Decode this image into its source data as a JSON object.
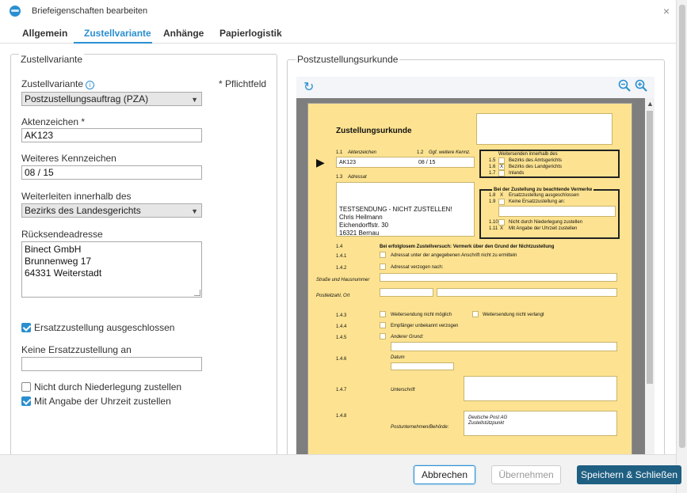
{
  "window": {
    "title": "Briefeigenschaften bearbeiten",
    "close_symbol": "×"
  },
  "tabs": [
    {
      "label": "Allgemein"
    },
    {
      "label": "Zustellvariante"
    },
    {
      "label": "Anhänge"
    },
    {
      "label": "Papierlogistik"
    }
  ],
  "form": {
    "legend": "Zustellvariante",
    "required_note": "* Pflichtfeld",
    "zustellvariante": {
      "label": "Zustellvariante",
      "value": "Postzustellungsauftrag (PZA)"
    },
    "aktenzeichen": {
      "label": "Aktenzeichen *",
      "value": "AK123"
    },
    "weiteres_kennzeichen": {
      "label": "Weiteres Kennzeichen",
      "value": "08 / 15"
    },
    "weiterleiten": {
      "label": "Weiterleiten innerhalb des",
      "value": "Bezirks des Landesgerichts"
    },
    "ruecksendeadresse": {
      "label": "Rücksendeadresse",
      "lines": [
        "Binect GmbH",
        "Brunnenweg 17",
        "64331 Weiterstadt"
      ]
    },
    "ersatzzustellung_ausgeschlossen": {
      "label": "Ersatzzustellung ausgeschlossen",
      "checked": true
    },
    "keine_ersatzzustellung": {
      "label": "Keine Ersatzzustellung an",
      "value": ""
    },
    "nicht_niederlegung": {
      "label": "Nicht durch Niederlegung zustellen",
      "checked": false
    },
    "mit_uhrzeit": {
      "label": "Mit Angabe der Uhrzeit zustellen",
      "checked": true
    }
  },
  "preview": {
    "legend": "Postzustellungsurkunde",
    "icons": {
      "refresh": "refresh-icon",
      "zoom_out": "zoom-out-icon",
      "zoom_in": "zoom-in-icon"
    },
    "doc": {
      "title": "Zustellungsurkunde",
      "n11": "1.1",
      "aktenzeichen_label": "Aktenzeichen",
      "aktenzeichen_value": "AK123",
      "n12": "1.2",
      "kennz_label": "Ggf. weitere Kennz.",
      "kennz_value": "08 / 15",
      "n13": "1.3",
      "adressat_label": "Adressat",
      "adressat_lines": [
        "TESTSENDUNG - NICHT ZUSTELLEN!",
        "Chris Heilmann",
        "Eichendorffstr. 30",
        "16321 Bernau"
      ],
      "weitersenden_title": "Weitersenden innerhalb des",
      "n15": "1.5",
      "ws_1": "Bezirks des Amtsgerichts",
      "n16": "1.6",
      "ws_2": "Bezirks des Landgerichts",
      "n17": "1.7",
      "ws_3": "Inlands",
      "vermerke_title": "Bei der Zustellung zu beachtende Vermerke",
      "n18": "1.8",
      "v_1": "Ersatzzustellung ausgeschlossen",
      "n19": "1.9",
      "v_2": "Keine Ersatzzustellung an:",
      "n110": "1.10",
      "v_3": "Nicht durch Niederlegung zustellen",
      "n111": "1.11",
      "v_4": "Mit Angabe der Uhrzeit zustellen",
      "n14": "1.4",
      "s14": "Bei erfolglosem Zustellversuch: Vermerk über den Grund der Nichtzustellung",
      "n141": "1.4.1",
      "s141": "Adressat unter der angegebenen Anschrift nicht zu ermitteln",
      "n142": "1.4.2",
      "s142": "Adressat verzogen nach:",
      "strasse": "Straße und Hausnummer",
      "plz": "Postleitzahl, Ort",
      "n143": "1.4.3",
      "s143a": "Weitersendung nicht möglich",
      "s143b": "Weitersendung nicht verlangt",
      "n144": "1.4.4",
      "s144": "Empfänger unbekannt verzogen",
      "n145": "1.4.5",
      "s145": "Anderer Grund:",
      "n146": "1.4.6",
      "datum": "Datum",
      "n147": "1.4.7",
      "unterschrift": "Unterschrift",
      "n148": "1.4.8",
      "postunternehmen": "Postunternehmen/Behörde:",
      "post_lines": [
        "Deutsche Post AG",
        "Zustellstützpunkt"
      ],
      "mark": "X"
    }
  },
  "buttons": {
    "cancel": "Abbrechen",
    "apply": "Übernehmen",
    "save": "Speichern & Schließen"
  },
  "colors": {
    "accent": "#2a8fd0",
    "primary_button": "#1f5f82",
    "document": "#fde391"
  }
}
